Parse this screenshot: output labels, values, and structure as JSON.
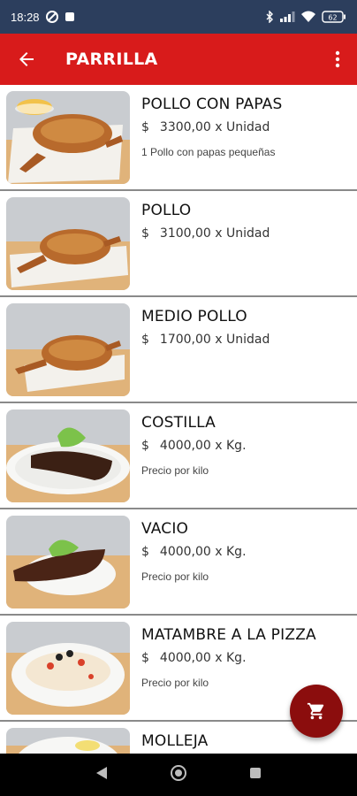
{
  "status_bar": {
    "time": "18:28",
    "battery": "62"
  },
  "app_bar": {
    "title": "PARRILLA"
  },
  "products": [
    {
      "name": "POLLO CON PAPAS",
      "currency": "$",
      "price": "3300,00 x Unidad",
      "description": "1 Pollo con papas pequeñas",
      "image": "roast-chicken-with-fries"
    },
    {
      "name": "POLLO",
      "currency": "$",
      "price": "3100,00 x Unidad",
      "description": "",
      "image": "roast-chicken"
    },
    {
      "name": "MEDIO POLLO",
      "currency": "$",
      "price": "1700,00 x Unidad",
      "description": "",
      "image": "roast-chicken"
    },
    {
      "name": "COSTILLA",
      "currency": "$",
      "price": "4000,00 x Kg.",
      "description": "Precio por kilo",
      "image": "ribs-plate"
    },
    {
      "name": "VACIO",
      "currency": "$",
      "price": "4000,00 x Kg.",
      "description": "Precio por kilo",
      "image": "flank-steak-plate"
    },
    {
      "name": "MATAMBRE A LA PIZZA",
      "currency": "$",
      "price": "4000,00 x Kg.",
      "description": "Precio por kilo",
      "image": "matambre-pizza-plate"
    },
    {
      "name": "MOLLEJA",
      "currency": "",
      "price": "",
      "description": "",
      "image": "sweetbreads-plate"
    }
  ],
  "colors": {
    "status_bar": "#2c3e5d",
    "app_bar": "#d81b1b",
    "fab": "#8b0d0d",
    "divider": "#8a8a8a",
    "nav_bar": "#000000"
  },
  "icons": {
    "back": "arrow-left-icon",
    "more": "more-vert-icon",
    "cart": "shopping-cart-icon",
    "nav_back": "triangle-back-icon",
    "nav_home": "circle-home-icon",
    "nav_recents": "square-recents-icon"
  }
}
